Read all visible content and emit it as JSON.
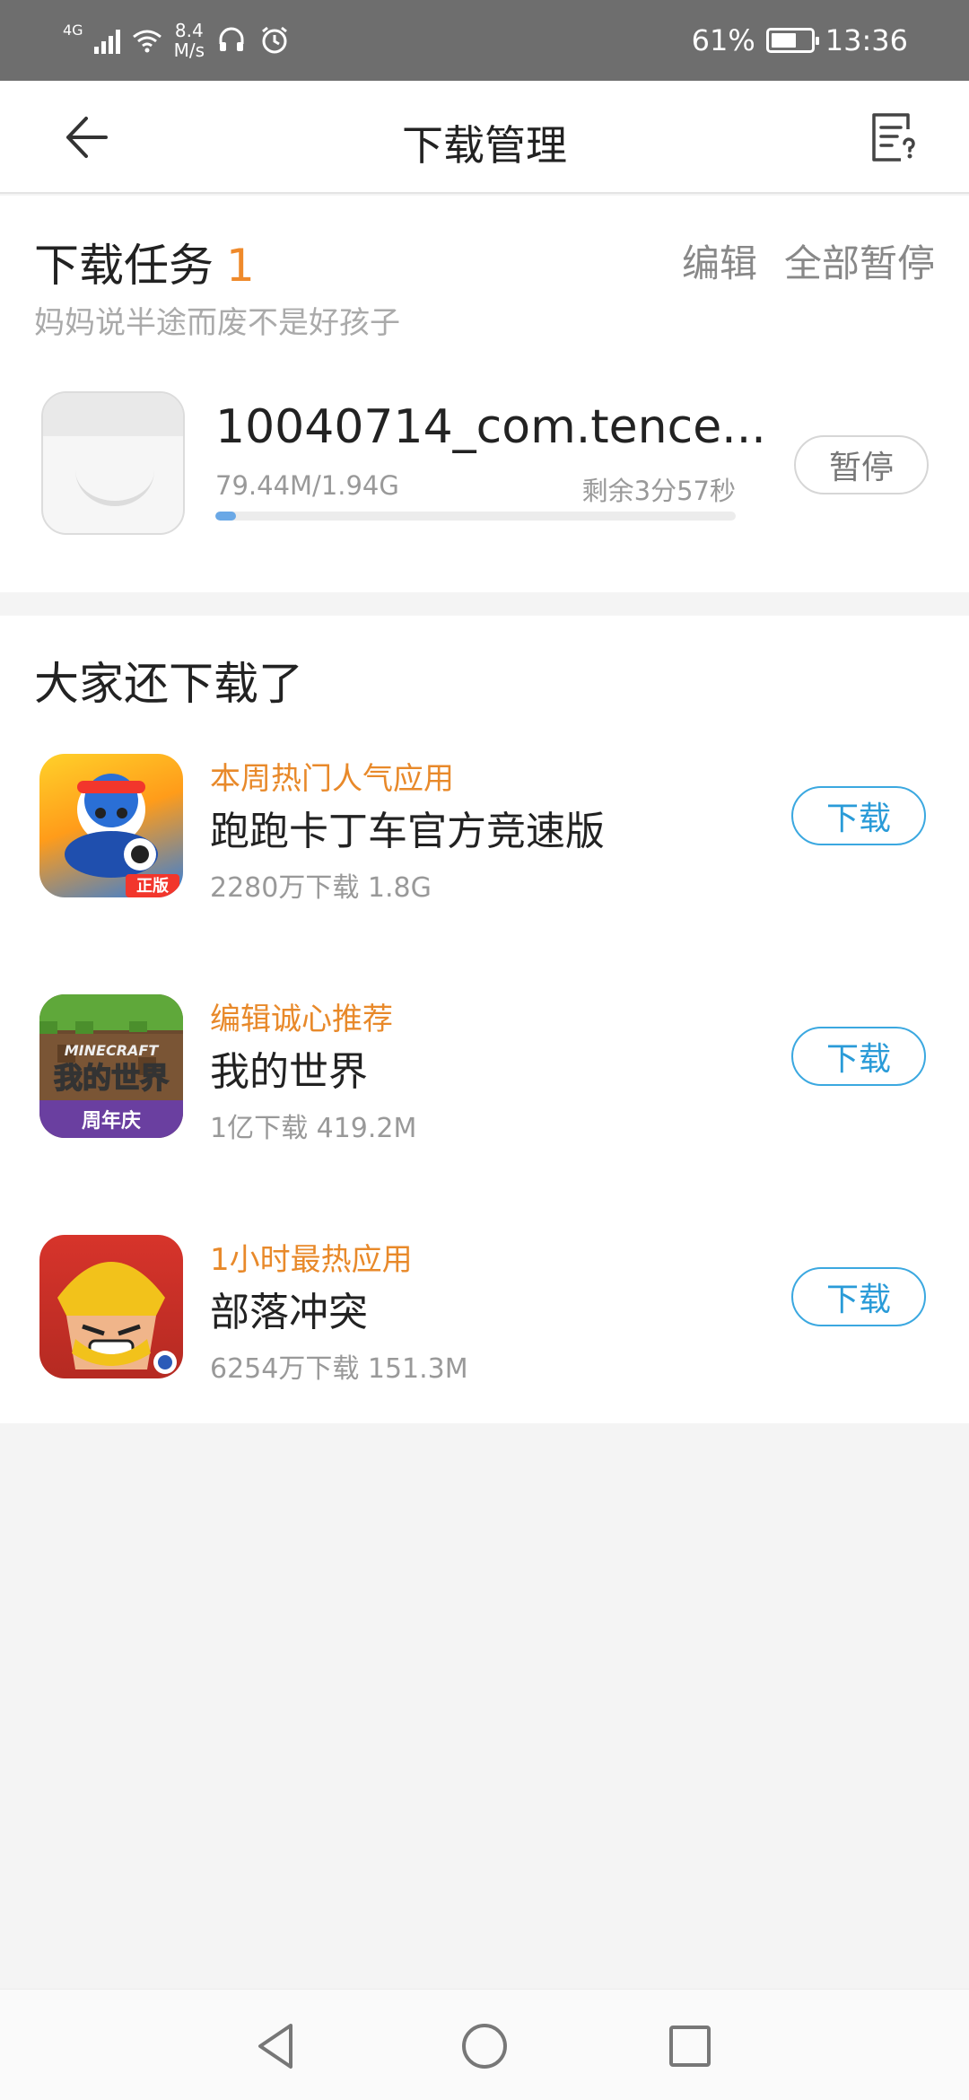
{
  "status_bar": {
    "network": "4G",
    "speed_value": "8.4",
    "speed_unit": "M/s",
    "battery": "61%",
    "battery_level": 0.61,
    "time": "13:36",
    "icons": [
      "signal-icon",
      "wifi-icon",
      "headset-icon",
      "alarm-icon",
      "battery-icon"
    ]
  },
  "header": {
    "title": "下载管理",
    "back_icon": "arrow-left-icon",
    "help_icon": "feedback-list-icon"
  },
  "download_tasks": {
    "title": "下载任务",
    "count": "1",
    "subtitle": "妈妈说半途而废不是好孩子",
    "edit_label": "编辑",
    "pause_all_label": "全部暂停",
    "items": [
      {
        "name": "10040714_com.tence...",
        "size": "79.44M/1.94G",
        "remaining": "剩余3分57秒",
        "progress": 0.04,
        "pause_label": "暂停",
        "progress_color": "#6aa8e6"
      }
    ]
  },
  "recommendations": {
    "title": "大家还下载了",
    "apps": [
      {
        "tag": "本周热门人气应用",
        "name": "跑跑卡丁车官方竞速版",
        "meta": "2280万下载   1.8G",
        "download_label": "下载",
        "icon": "kart-rider-icon",
        "badge": "正版"
      },
      {
        "tag": "编辑诚心推荐",
        "name": "我的世界",
        "meta": "1亿下载   419.2M",
        "download_label": "下载",
        "icon": "minecraft-icon",
        "logo": "MINECRAFT",
        "logo_cn": "我的世界",
        "badge": "周年庆"
      },
      {
        "tag": "1小时最热应用",
        "name": "部落冲突",
        "meta": "6254万下载   151.3M",
        "download_label": "下载",
        "icon": "clash-of-clans-icon"
      }
    ]
  },
  "colors": {
    "accent_orange": "#ef8a2b",
    "accent_blue": "#2a9bd8",
    "status_bar_bg": "#6e6e6e"
  },
  "system_nav": {
    "icons": [
      "back-triangle-icon",
      "home-circle-icon",
      "recents-square-icon"
    ]
  }
}
